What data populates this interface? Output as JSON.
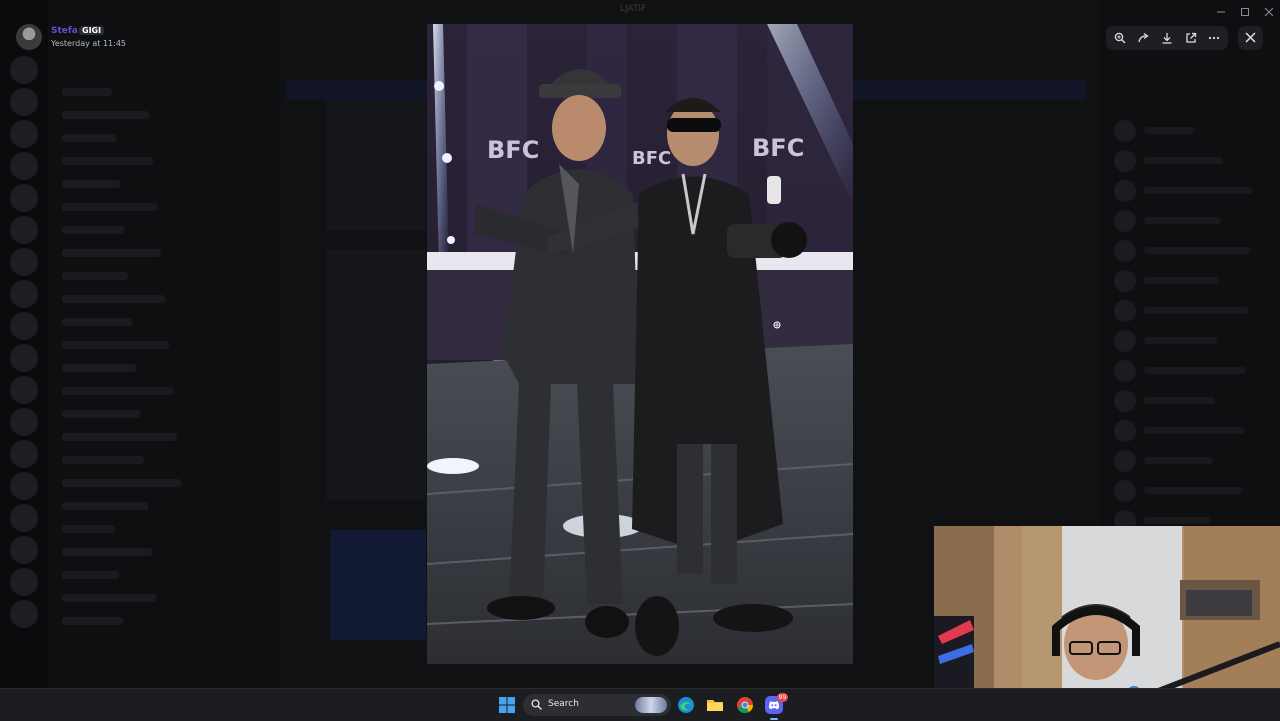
{
  "window": {
    "title": "LJATIF"
  },
  "author": {
    "name": "Stefa",
    "badge": "GIGI",
    "timestamp": "Yesterday at 11:45"
  },
  "toolbar": {
    "actions": [
      "zoom-in",
      "forward",
      "download",
      "open-in-browser",
      "more-options"
    ],
    "close": "close"
  },
  "photo": {
    "subject": "two men posing on BFC stage",
    "backdrop_text": "BFC",
    "colors": {
      "backdrop": "#2b2338",
      "light_beam": "#cfe3ff",
      "floor": "#3c3f45",
      "coat": "#1c1c1e"
    }
  },
  "taskbar": {
    "search_placeholder": "Search",
    "apps": [
      "start-menu",
      "search",
      "edge",
      "file-explorer",
      "chrome",
      "discord"
    ],
    "discord_badge": "99"
  },
  "colors": {
    "overlay_bg": "#0b0c0e",
    "toolbar_bg": "#1e1f22",
    "taskbar_bg": "#1b1d20",
    "author_name": "#6a4cc9",
    "accent": "#5865f2"
  }
}
